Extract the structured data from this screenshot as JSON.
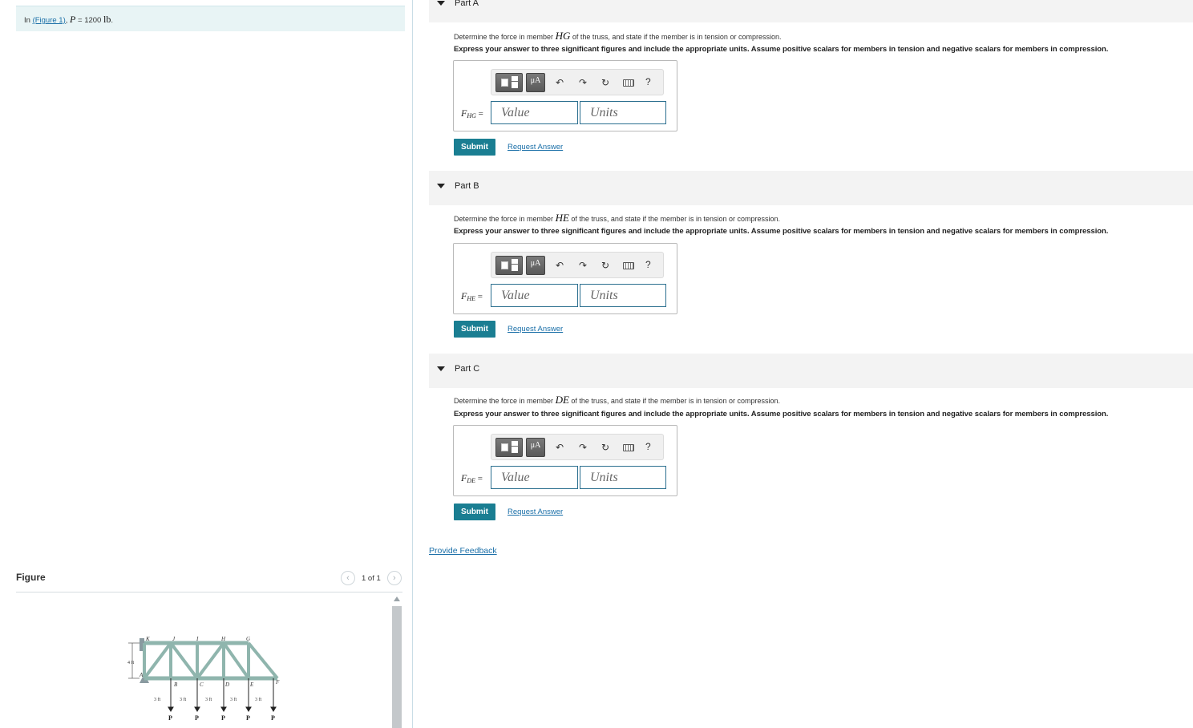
{
  "problem": {
    "prefix": "In ",
    "figure_link": "(Figure 1)",
    "after_link": ", ",
    "var": "P",
    "equals": " = 1200 ",
    "unit": "lb",
    "end": "."
  },
  "figure": {
    "title": "Figure",
    "page_count": "1 of 1",
    "prev_icon": "chevron-left-icon",
    "next_icon": "chevron-right-icon",
    "labels": {
      "top_nodes": [
        "K",
        "J",
        "I",
        "H",
        "G"
      ],
      "bottom_nodes": [
        "A",
        "B",
        "C",
        "D",
        "E",
        "F"
      ],
      "height": "4 ft",
      "spans": [
        "3 ft",
        "3 ft",
        "3 ft",
        "3 ft",
        "3 ft"
      ],
      "loads": [
        "P",
        "P",
        "P",
        "P",
        "P"
      ]
    }
  },
  "parts": [
    {
      "title": "Part A",
      "question_pre": "Determine the force in member ",
      "member": "HG",
      "question_post": " of the truss, and state if the member is in tension or compression.",
      "instruction": "Express your answer to three significant figures and include the appropriate units. Assume positive scalars for members in tension and negative scalars for members in compression.",
      "answer_var": "F",
      "answer_sub": "HG",
      "answer_eq": " =",
      "value_placeholder": "Value",
      "units_placeholder": "Units",
      "submit": "Submit",
      "request": "Request Answer"
    },
    {
      "title": "Part B",
      "question_pre": "Determine the force in member ",
      "member": "HE",
      "question_post": " of the truss, and state if the member is in tension or compression.",
      "instruction": "Express your answer to three significant figures and include the appropriate units. Assume positive scalars for members in tension and negative scalars for members in compression.",
      "answer_var": "F",
      "answer_sub": "HE",
      "answer_eq": " =",
      "value_placeholder": "Value",
      "units_placeholder": "Units",
      "submit": "Submit",
      "request": "Request Answer"
    },
    {
      "title": "Part C",
      "question_pre": "Determine the force in member ",
      "member": "DE",
      "question_post": " of the truss, and state if the member is in tension or compression.",
      "instruction": "Express your answer to three significant figures and include the appropriate units. Assume positive scalars for members in tension and negative scalars for members in compression.",
      "answer_var": "F",
      "answer_sub": "DE",
      "answer_eq": " =",
      "value_placeholder": "Value",
      "units_placeholder": "Units",
      "submit": "Submit",
      "request": "Request Answer"
    }
  ],
  "toolbar": {
    "mu_label": "μA",
    "undo_icon": "undo-icon",
    "redo_icon": "redo-icon",
    "reset_icon": "reset-icon",
    "keyboard_icon": "keyboard-icon",
    "help_label": "?"
  },
  "feedback": "Provide Feedback",
  "colors": {
    "accent": "#1a7e92",
    "link": "#1a6fa8",
    "truss_member": "#8fb5ad",
    "problem_bg": "#e8f4f5"
  }
}
